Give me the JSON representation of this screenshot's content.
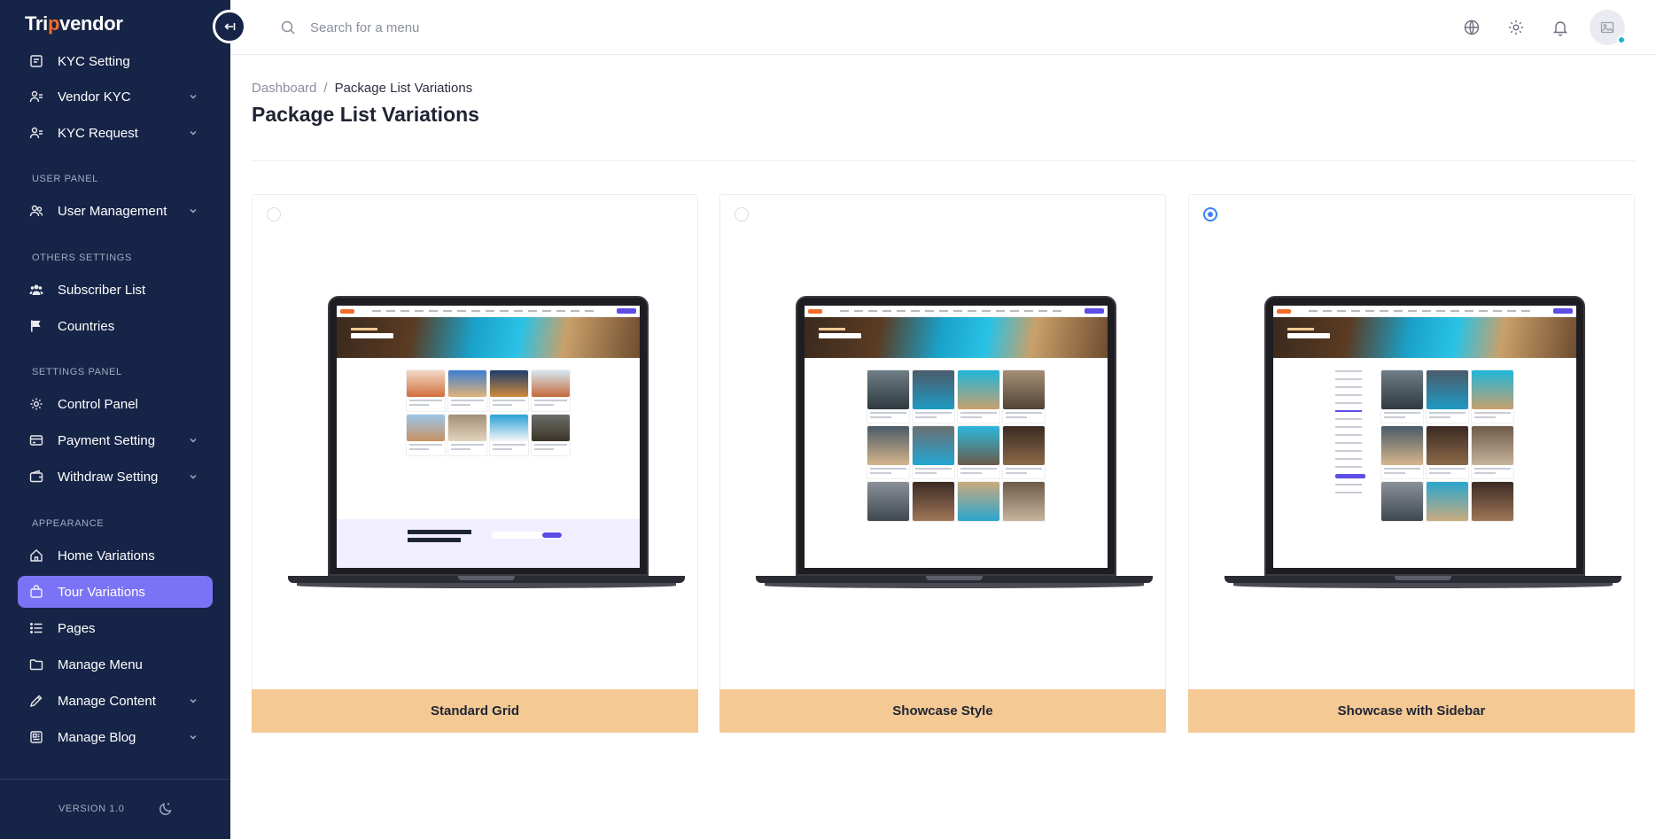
{
  "app": {
    "logo_text_before": "Tri",
    "logo_text_mark": "p",
    "logo_text_after": "vendor"
  },
  "sidebar": {
    "items": [
      {
        "label": "KYC Setting",
        "icon": "kyc-setting-icon",
        "has_submenu": false,
        "active": false
      },
      {
        "label": "Vendor KYC",
        "icon": "vendor-kyc-icon",
        "has_submenu": true,
        "active": false
      },
      {
        "label": "KYC Request",
        "icon": "kyc-request-icon",
        "has_submenu": true,
        "active": false
      },
      {
        "label": "User Management",
        "icon": "users-icon",
        "has_submenu": true,
        "active": false
      },
      {
        "label": "Subscriber List",
        "icon": "subscribers-icon",
        "has_submenu": false,
        "active": false
      },
      {
        "label": "Countries",
        "icon": "flag-icon",
        "has_submenu": false,
        "active": false
      },
      {
        "label": "Control Panel",
        "icon": "gear-icon",
        "has_submenu": false,
        "active": false
      },
      {
        "label": "Payment Setting",
        "icon": "payment-icon",
        "has_submenu": true,
        "active": false
      },
      {
        "label": "Withdraw Setting",
        "icon": "wallet-icon",
        "has_submenu": true,
        "active": false
      },
      {
        "label": "Home Variations",
        "icon": "home-icon",
        "has_submenu": false,
        "active": false
      },
      {
        "label": "Tour Variations",
        "icon": "bag-icon",
        "has_submenu": false,
        "active": true
      },
      {
        "label": "Pages",
        "icon": "list-icon",
        "has_submenu": false,
        "active": false
      },
      {
        "label": "Manage Menu",
        "icon": "folder-icon",
        "has_submenu": false,
        "active": false
      },
      {
        "label": "Manage Content",
        "icon": "pencil-icon",
        "has_submenu": true,
        "active": false
      },
      {
        "label": "Manage Blog",
        "icon": "blog-icon",
        "has_submenu": true,
        "active": false
      }
    ],
    "sections": {
      "user_panel": "USER PANEL",
      "others_settings": "OTHERS SETTINGS",
      "settings_panel": "SETTINGS PANEL",
      "appearance": "APPEARANCE"
    },
    "version": "VERSION 1.0"
  },
  "header": {
    "search_placeholder": "Search for a menu",
    "icons": [
      "globe-icon",
      "gear-icon",
      "bell-icon",
      "avatar-image-icon"
    ]
  },
  "main": {
    "breadcrumb": {
      "root": "Dashboard",
      "separator": "/",
      "current": "Package List Variations"
    },
    "title": "Package List Variations",
    "options": [
      {
        "label": "Standard Grid",
        "selected": false
      },
      {
        "label": "Showcase Style",
        "selected": false
      },
      {
        "label": "Showcase with Sidebar",
        "selected": true
      }
    ]
  },
  "colors": {
    "sidebar_bg": "#162447",
    "active_item": "#7b73f5",
    "option_footer": "#f4c994",
    "radio_selected": "#3b82f6",
    "brand_orange": "#f26c2a"
  }
}
